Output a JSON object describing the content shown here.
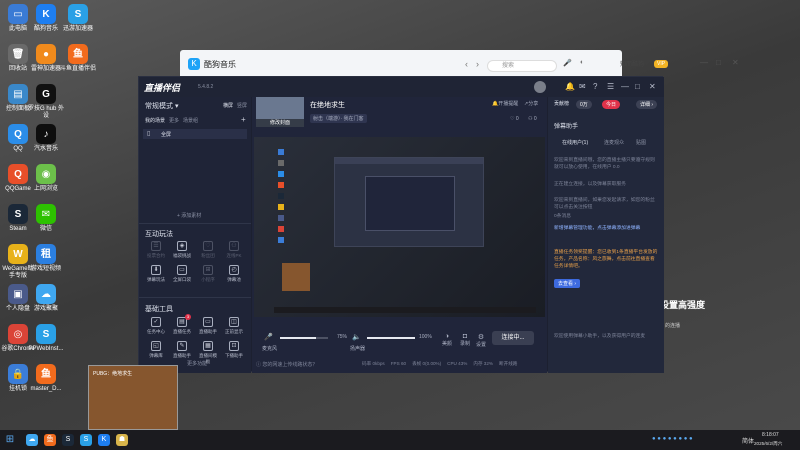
{
  "desktop_icons": [
    {
      "label": "此电脑",
      "glyph": "▭",
      "color": "#3a7bd5"
    },
    {
      "label": "酷狗音乐",
      "glyph": "K",
      "color": "#1e7ef0"
    },
    {
      "label": "迅游加速器",
      "glyph": "S",
      "color": "#2aa0e6"
    },
    {
      "label": "回收站",
      "glyph": "🗑",
      "color": "#6a6a6a"
    },
    {
      "label": "雷神加速器",
      "glyph": "●",
      "color": "#f08a1c"
    },
    {
      "label": "斗鱼直播伴侣",
      "glyph": "鱼",
      "color": "#f26b1d"
    },
    {
      "label": "控制面板",
      "glyph": "▤",
      "color": "#3a88c9"
    },
    {
      "label": "罗技G hub 外设",
      "glyph": "G",
      "color": "#111111"
    },
    {
      "label": "QQ",
      "glyph": "Q",
      "color": "#2b8de8"
    },
    {
      "label": "汽水音乐",
      "glyph": "♪",
      "color": "#0e0e0e"
    },
    {
      "label": "QQGame",
      "glyph": "Q",
      "color": "#e84f2a"
    },
    {
      "label": "上网浏览",
      "glyph": "◉",
      "color": "#6cc04a"
    },
    {
      "label": "Steam",
      "glyph": "S",
      "color": "#1b2838"
    },
    {
      "label": "微信",
      "glyph": "✉",
      "color": "#2dc100"
    },
    {
      "label": "WeGame助手专版",
      "glyph": "W",
      "color": "#e8b21a"
    },
    {
      "label": "游戏短视频",
      "glyph": "租",
      "color": "#2b7fe0"
    },
    {
      "label": "个人隐盘",
      "glyph": "▣",
      "color": "#4a5a8a"
    },
    {
      "label": "游戏聚聚",
      "glyph": "☁",
      "color": "#3fa7f0"
    },
    {
      "label": "谷歌Chrome",
      "glyph": "◎",
      "color": "#db4437"
    },
    {
      "label": "PPWebInst...",
      "glyph": "S",
      "color": "#2aa0e6"
    },
    {
      "label": "挂机锁",
      "glyph": "🔒",
      "color": "#3b7dd8"
    },
    {
      "label": "master_D...",
      "glyph": "鱼",
      "color": "#f26b1d"
    }
  ],
  "music_window": {
    "logo": "K",
    "title": "酷狗音乐",
    "search_placeholder": "搜索",
    "user": "知而酷狗",
    "vip_badge": "VIP",
    "nav_back": "‹",
    "nav_forward": "›",
    "win_minimize": "—",
    "win_maximize": "□",
    "win_close": "✕",
    "mic_icon": "🎤",
    "skin_icon": "◐"
  },
  "app": {
    "brand": "直播伴侣",
    "version": "5.4.8.2",
    "topbar_icons": [
      "🔔",
      "✉",
      "?",
      "☰",
      "—",
      "□",
      "✕"
    ],
    "left": {
      "mode": "常规模式 ▾",
      "mode_tabs": [
        "横屏",
        "竖屏"
      ],
      "scene_tabs": [
        "我的场景",
        "更多",
        "场景组"
      ],
      "add_scene": "+",
      "source_item": "全屏",
      "add_source": "+ 添加素材",
      "interact_title": "互动玩法",
      "interact_tools": [
        {
          "label": "投票合约",
          "glyph": "☰",
          "dim": true
        },
        {
          "label": "福袋挑战",
          "glyph": "◈",
          "dim": false
        },
        {
          "label": "粉丝团",
          "glyph": "♡",
          "dim": true
        },
        {
          "label": "连线PK",
          "glyph": "⚇",
          "dim": true
        },
        {
          "label": "弹幕玩法",
          "glyph": "⬇",
          "dim": false
        },
        {
          "label": "全屏口袋",
          "glyph": "▭",
          "dim": false
        },
        {
          "label": "小程序",
          "glyph": "⊞",
          "dim": true
        },
        {
          "label": "弹幕池",
          "glyph": "◴",
          "dim": false
        }
      ],
      "basic_title": "基础工具",
      "basic_tools": [
        {
          "label": "任务中心",
          "glyph": "✓",
          "badge": ""
        },
        {
          "label": "直播任务",
          "glyph": "▤",
          "badge": "3"
        },
        {
          "label": "直播助手",
          "glyph": "▭",
          "badge": ""
        },
        {
          "label": "正前显示",
          "glyph": "◫",
          "badge": ""
        },
        {
          "label": "弹幕库",
          "glyph": "◱",
          "badge": ""
        },
        {
          "label": "直播助手",
          "glyph": "✎",
          "badge": ""
        },
        {
          "label": "直播间模板",
          "glyph": "▦",
          "badge": ""
        },
        {
          "label": "下播助手",
          "glyph": "⊡",
          "badge": ""
        }
      ],
      "more": "更多功能"
    },
    "center": {
      "cover_label": "修改封面",
      "stream_title": "在绝地求生",
      "category": "射击（端游）· 我在门客",
      "start_notice": "开播提醒",
      "share": "分享",
      "stat_likes": "0",
      "stat_hot": "0",
      "mic_label": "麦克风",
      "mic_pct": "75%",
      "speaker_label": "扬声器",
      "speaker_pct": "100%",
      "ctrl_beauty": "美颜",
      "ctrl_record": "录制",
      "ctrl_settings": "设置",
      "go_live": "连接中...",
      "status_text": "您的网速上传线路状态？",
      "status_stats": [
        "码率 0kbps",
        "FPS 60",
        "丢帧 0(0.00%)",
        "CPU 43%",
        "内存 32%",
        "断开线路"
      ]
    },
    "right": {
      "tabs": [
        "贡献榜",
        "0万"
      ],
      "heat_label": "今日",
      "detail_btn": "详细 ›",
      "section_title": "弹幕助手",
      "user_tabs": [
        "在线用户(1)",
        "连麦观众",
        "贴图"
      ],
      "msgs": [
        {
          "text": "欢迎来到直播间哦，您的直播主播只要遵守规则就可以放心使用，在线用户 0.0",
          "hl": false
        },
        {
          "text": "正在建立连接，以及弹幕获取服务",
          "hl": false
        },
        {
          "text": "欢迎来到直播间，如果您发起请求，如您的粉丝可以点击关注按钮",
          "hl": false
        },
        {
          "text": "0条消息",
          "hl": false
        },
        {
          "text": "新增弹幕管理功能，点击弹幕添加进弹幕",
          "hl": true
        },
        {
          "text": "直播任务领奖提醒：您已收到1条直播平台发放的任务，产品名称：风之旅舞，点击前往直播查看任务详情吧。",
          "hl": true
        }
      ],
      "go_view": "去查看 ›",
      "bottom_text": "欢迎使用弹幕小助手，以及获得用户的连麦"
    }
  },
  "thumbnail": {
    "title": "PUBG：绝地求生"
  },
  "bg_text": {
    "headline": "设置高强度",
    "snippet": "的连播"
  },
  "taskbar": {
    "start": "⊞",
    "apps": [
      {
        "glyph": "☁",
        "color": "#3fa7f0"
      },
      {
        "glyph": "鱼",
        "color": "#f26b1d"
      },
      {
        "glyph": "S",
        "color": "#1b2838"
      },
      {
        "glyph": "S",
        "color": "#2aa0e6"
      },
      {
        "glyph": "K",
        "color": "#1e7ef0"
      },
      {
        "glyph": "☗",
        "color": "#d8b44a"
      }
    ],
    "tray_text": "简体",
    "time": "8:18:07",
    "date": "2025/6/2/周六"
  }
}
